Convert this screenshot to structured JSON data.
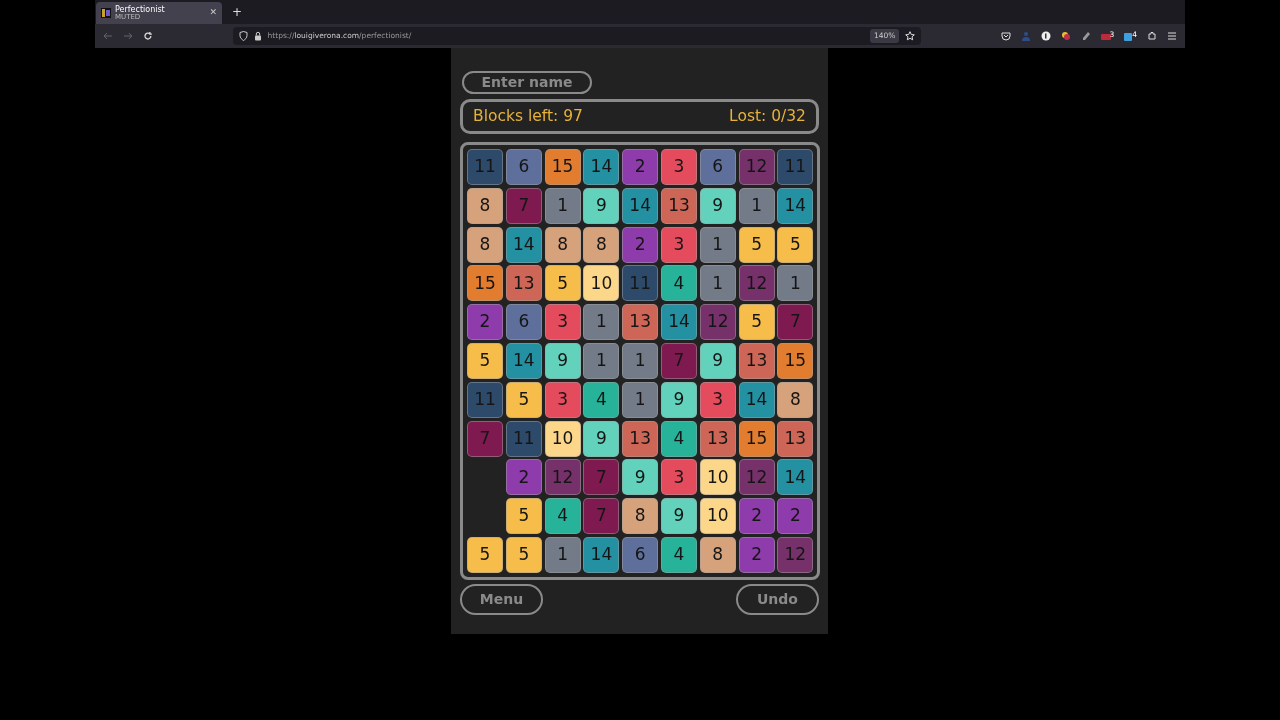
{
  "browser": {
    "tab": {
      "title": "Perfectionist",
      "subtitle": "MUTED",
      "close": "✕"
    },
    "new_tab": "+",
    "url": {
      "scheme": "https://",
      "host": "louigiverona.com",
      "path": "/perfectionist/"
    },
    "zoom": "140%",
    "badges": [
      "3",
      "4"
    ]
  },
  "name_field": {
    "placeholder": "Enter name"
  },
  "status": {
    "blocks_left": "Blocks left: 97",
    "lost": "Lost: 0/32"
  },
  "grid": [
    [
      {
        "value": "11",
        "color": "#2d4a6a"
      },
      {
        "value": "6",
        "color": "#5e6f9c"
      },
      {
        "value": "15",
        "color": "#e27c2f"
      },
      {
        "value": "14",
        "color": "#2491a3"
      },
      {
        "value": "2",
        "color": "#8e3bab"
      },
      {
        "value": "3",
        "color": "#e44c5e"
      },
      {
        "value": "6",
        "color": "#5e6f9c"
      },
      {
        "value": "12",
        "color": "#76316a"
      },
      {
        "value": "11",
        "color": "#2d4a6a"
      }
    ],
    [
      {
        "value": "8",
        "color": "#d6a27c"
      },
      {
        "value": "7",
        "color": "#7e1a4f"
      },
      {
        "value": "1",
        "color": "#737b89"
      },
      {
        "value": "9",
        "color": "#62d2bd"
      },
      {
        "value": "14",
        "color": "#2491a3"
      },
      {
        "value": "13",
        "color": "#cd6656"
      },
      {
        "value": "9",
        "color": "#62d2bd"
      },
      {
        "value": "1",
        "color": "#737b89"
      },
      {
        "value": "14",
        "color": "#2491a3"
      }
    ],
    [
      {
        "value": "8",
        "color": "#d6a27c"
      },
      {
        "value": "14",
        "color": "#2491a3"
      },
      {
        "value": "8",
        "color": "#d6a27c"
      },
      {
        "value": "8",
        "color": "#d6a27c"
      },
      {
        "value": "2",
        "color": "#8e3bab"
      },
      {
        "value": "3",
        "color": "#e44c5e"
      },
      {
        "value": "1",
        "color": "#737b89"
      },
      {
        "value": "5",
        "color": "#f6bd4a"
      },
      {
        "value": "5",
        "color": "#f6bd4a"
      }
    ],
    [
      {
        "value": "15",
        "color": "#e27c2f"
      },
      {
        "value": "13",
        "color": "#cd6656"
      },
      {
        "value": "5",
        "color": "#f6bd4a"
      },
      {
        "value": "10",
        "color": "#fcd78a"
      },
      {
        "value": "11",
        "color": "#2d4a6a"
      },
      {
        "value": "4",
        "color": "#26b39a"
      },
      {
        "value": "1",
        "color": "#737b89"
      },
      {
        "value": "12",
        "color": "#76316a"
      },
      {
        "value": "1",
        "color": "#737b89"
      }
    ],
    [
      {
        "value": "2",
        "color": "#8e3bab"
      },
      {
        "value": "6",
        "color": "#5e6f9c"
      },
      {
        "value": "3",
        "color": "#e44c5e"
      },
      {
        "value": "1",
        "color": "#737b89"
      },
      {
        "value": "13",
        "color": "#cd6656"
      },
      {
        "value": "14",
        "color": "#2491a3"
      },
      {
        "value": "12",
        "color": "#76316a"
      },
      {
        "value": "5",
        "color": "#f6bd4a"
      },
      {
        "value": "7",
        "color": "#7e1a4f"
      }
    ],
    [
      {
        "value": "5",
        "color": "#f6bd4a"
      },
      {
        "value": "14",
        "color": "#2491a3"
      },
      {
        "value": "9",
        "color": "#62d2bd"
      },
      {
        "value": "1",
        "color": "#737b89"
      },
      {
        "value": "1",
        "color": "#737b89"
      },
      {
        "value": "7",
        "color": "#7e1a4f"
      },
      {
        "value": "9",
        "color": "#62d2bd"
      },
      {
        "value": "13",
        "color": "#cd6656"
      },
      {
        "value": "15",
        "color": "#e27c2f"
      }
    ],
    [
      {
        "value": "11",
        "color": "#2d4a6a"
      },
      {
        "value": "5",
        "color": "#f6bd4a"
      },
      {
        "value": "3",
        "color": "#e44c5e"
      },
      {
        "value": "4",
        "color": "#26b39a"
      },
      {
        "value": "1",
        "color": "#737b89"
      },
      {
        "value": "9",
        "color": "#62d2bd"
      },
      {
        "value": "3",
        "color": "#e44c5e"
      },
      {
        "value": "14",
        "color": "#2491a3"
      },
      {
        "value": "8",
        "color": "#d6a27c"
      }
    ],
    [
      {
        "value": "7",
        "color": "#7e1a4f"
      },
      {
        "value": "11",
        "color": "#2d4a6a"
      },
      {
        "value": "10",
        "color": "#fcd78a"
      },
      {
        "value": "9",
        "color": "#62d2bd"
      },
      {
        "value": "13",
        "color": "#cd6656"
      },
      {
        "value": "4",
        "color": "#26b39a"
      },
      {
        "value": "13",
        "color": "#cd6656"
      },
      {
        "value": "15",
        "color": "#e27c2f"
      },
      {
        "value": "13",
        "color": "#cd6656"
      }
    ],
    [
      {
        "kind": "empty"
      },
      {
        "value": "2",
        "color": "#8e3bab"
      },
      {
        "value": "12",
        "color": "#76316a"
      },
      {
        "value": "7",
        "color": "#7e1a4f"
      },
      {
        "value": "9",
        "color": "#62d2bd"
      },
      {
        "value": "3",
        "color": "#e44c5e"
      },
      {
        "value": "10",
        "color": "#fcd78a"
      },
      {
        "value": "12",
        "color": "#76316a"
      },
      {
        "value": "14",
        "color": "#2491a3"
      }
    ],
    [
      {
        "kind": "empty"
      },
      {
        "value": "5",
        "color": "#f6bd4a"
      },
      {
        "value": "4",
        "color": "#26b39a"
      },
      {
        "value": "7",
        "color": "#7e1a4f"
      },
      {
        "value": "8",
        "color": "#d6a27c"
      },
      {
        "value": "9",
        "color": "#62d2bd"
      },
      {
        "value": "10",
        "color": "#fcd78a"
      },
      {
        "value": "2",
        "color": "#8e3bab"
      },
      {
        "value": "2",
        "color": "#8e3bab"
      }
    ],
    [
      {
        "value": "5",
        "color": "#f6bd4a"
      },
      {
        "value": "5",
        "color": "#f6bd4a"
      },
      {
        "value": "1",
        "color": "#737b89"
      },
      {
        "value": "14",
        "color": "#2491a3"
      },
      {
        "value": "6",
        "color": "#5e6f9c"
      },
      {
        "value": "4",
        "color": "#26b39a"
      },
      {
        "value": "8",
        "color": "#d6a27c"
      },
      {
        "value": "2",
        "color": "#8e3bab"
      },
      {
        "value": "12",
        "color": "#76316a"
      }
    ]
  ],
  "buttons": {
    "menu": "Menu",
    "undo": "Undo"
  }
}
